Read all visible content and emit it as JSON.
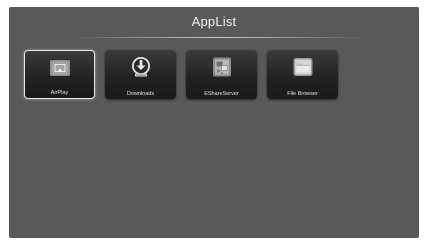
{
  "header": {
    "title": "AppList"
  },
  "apps": [
    {
      "label": "AirPlay",
      "icon": "airplay-icon",
      "selected": true
    },
    {
      "label": "Downloads",
      "icon": "download-icon",
      "selected": false
    },
    {
      "label": "EShareServer",
      "icon": "eshare-server-icon",
      "selected": false
    },
    {
      "label": "File Browser",
      "icon": "folder-icon",
      "selected": false
    }
  ],
  "colors": {
    "background": "#59595b",
    "tile": "#232323",
    "text": "#f2f2f2",
    "selection_border": "#e8e8e8"
  }
}
